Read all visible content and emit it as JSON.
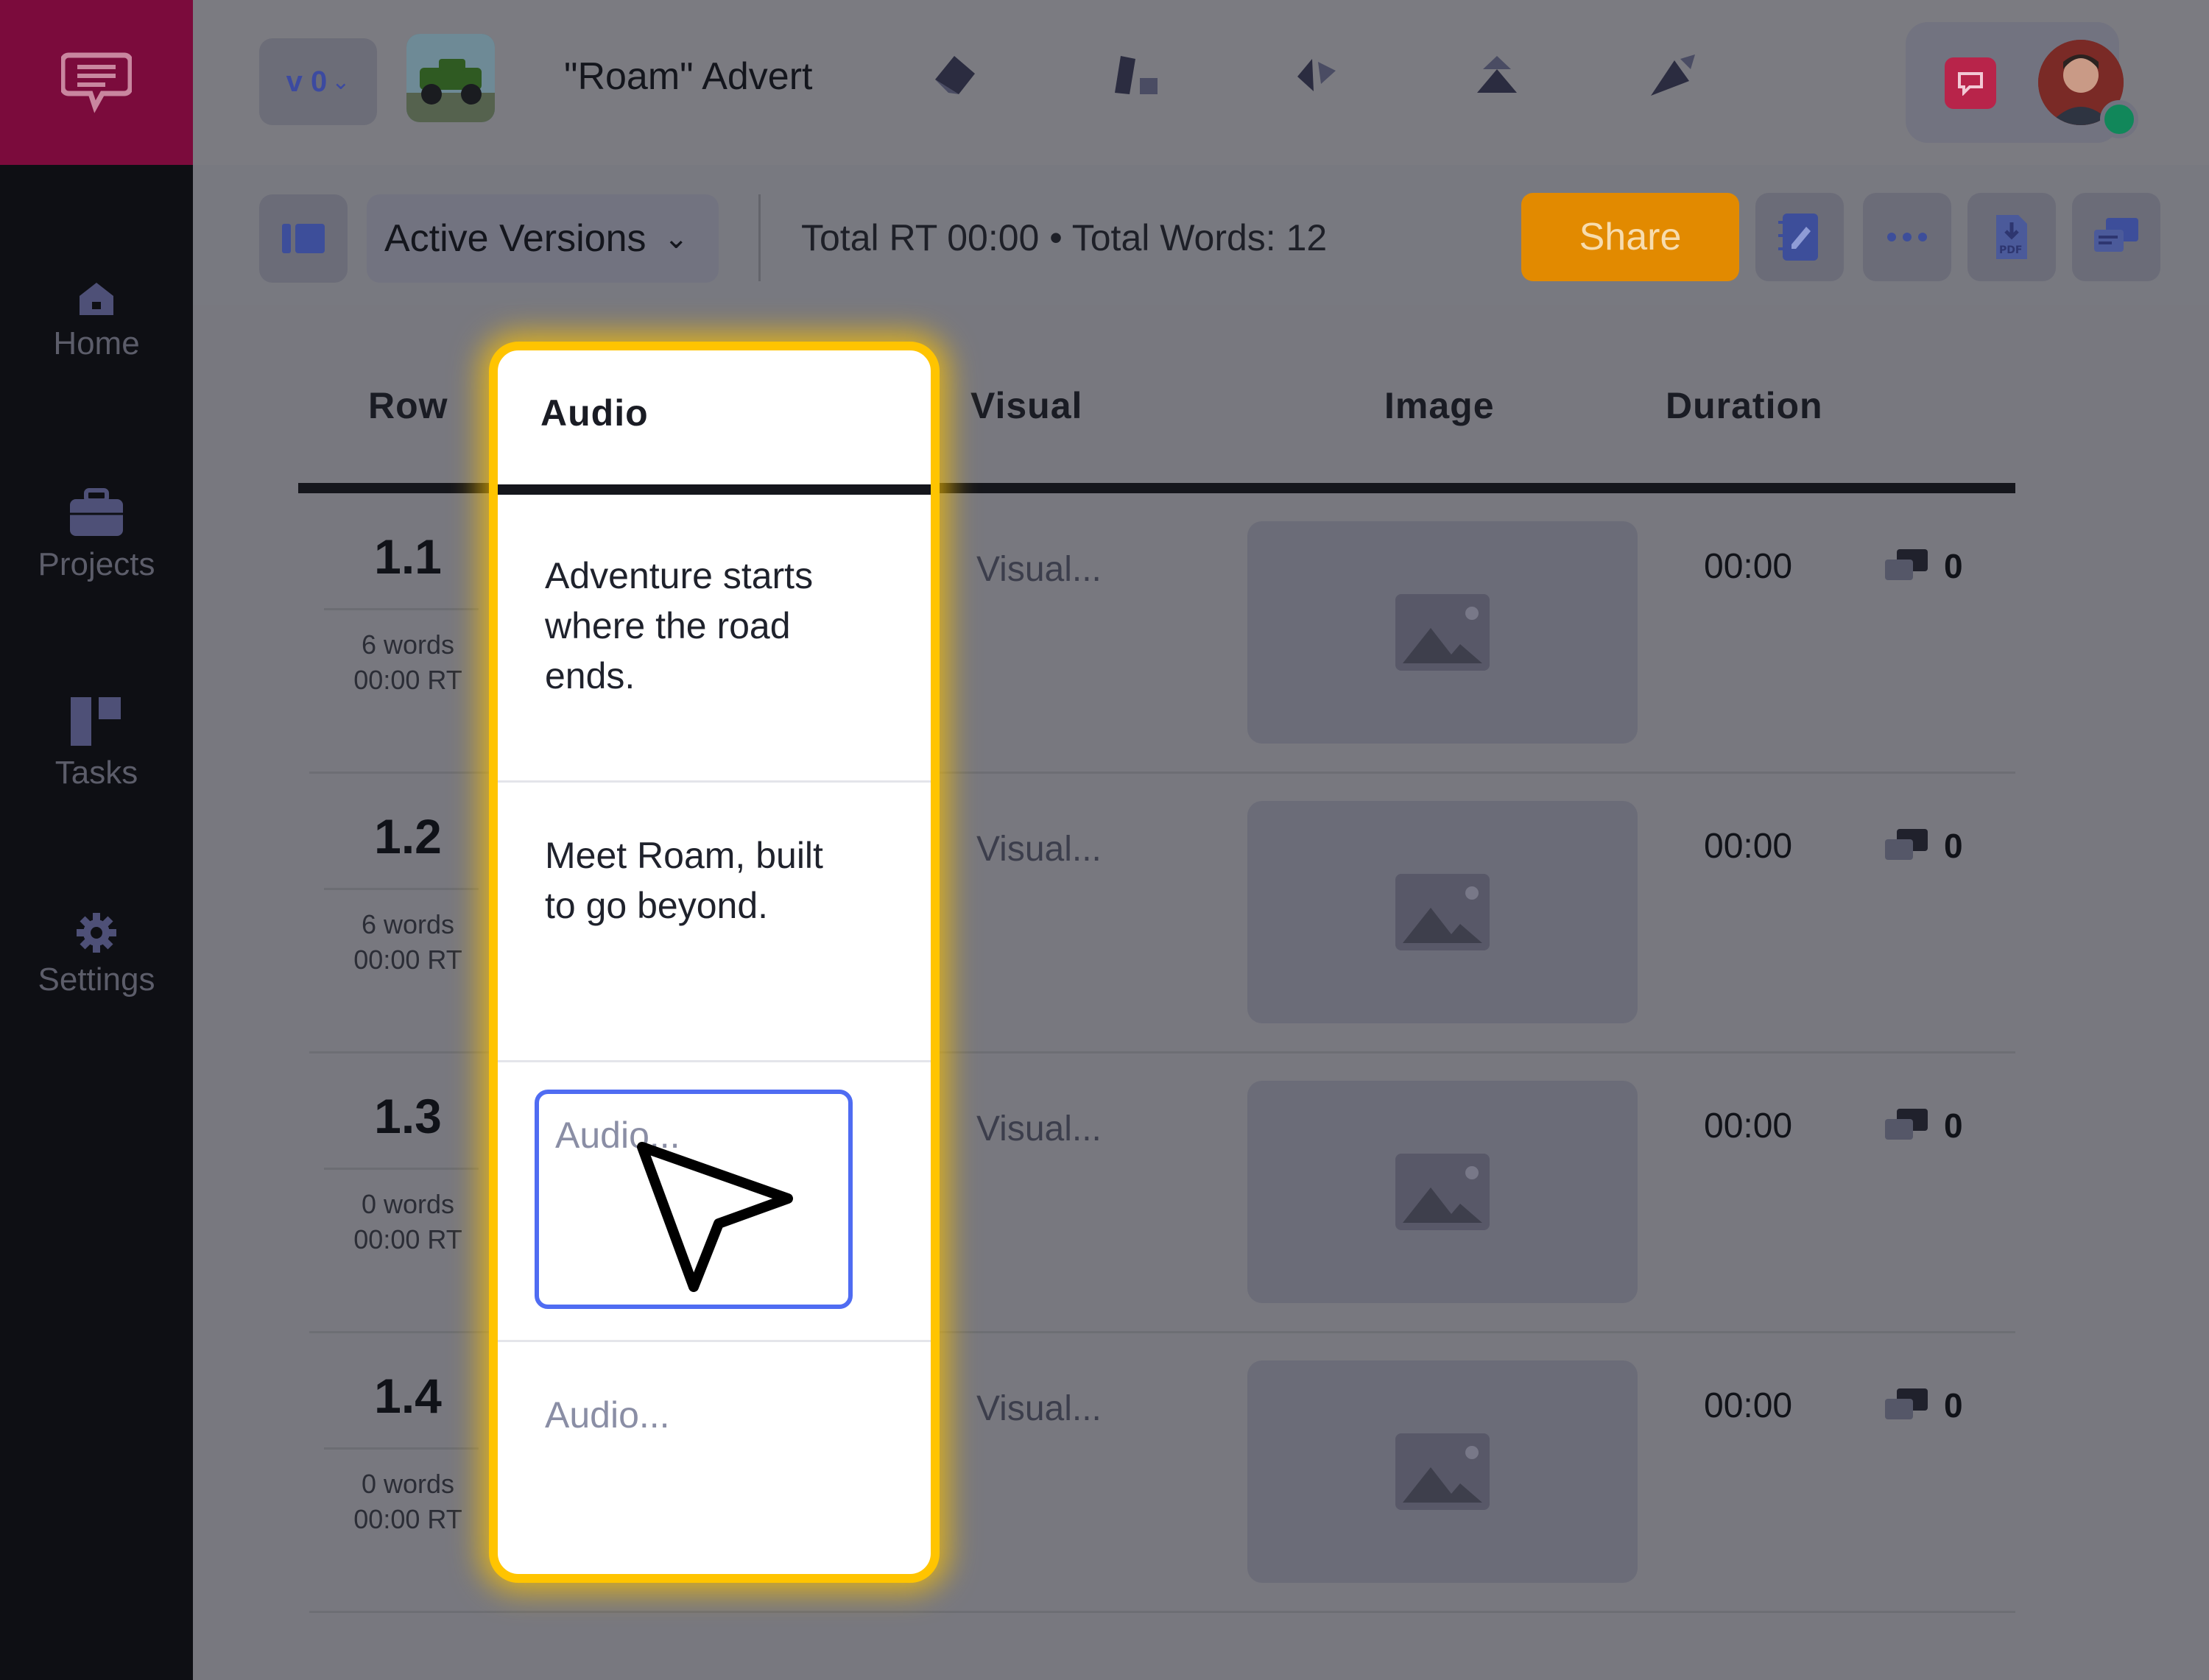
{
  "sidebar": {
    "items": [
      {
        "label": "Home",
        "icon": "home-icon"
      },
      {
        "label": "Projects",
        "icon": "briefcase-icon"
      },
      {
        "label": "Tasks",
        "icon": "tasks-icon"
      },
      {
        "label": "Settings",
        "icon": "gear-icon"
      }
    ]
  },
  "header": {
    "version_label": "v 0",
    "title": "\"Roam\" Advert"
  },
  "toolbar": {
    "versions_label": "Active Versions",
    "totals": "Total RT 00:00 • Total Words: 12",
    "share_label": "Share"
  },
  "table": {
    "headers": {
      "row": "Row",
      "audio": "Audio",
      "visual": "Visual",
      "image": "Image",
      "duration": "Duration"
    },
    "rows": [
      {
        "num": "1.1",
        "words": "6 words",
        "rt": "00:00 RT",
        "audio": "Adventure starts where the road ends.",
        "visual": "Visual...",
        "duration": "00:00",
        "comments": "0"
      },
      {
        "num": "1.2",
        "words": "6 words",
        "rt": "00:00 RT",
        "audio": "Meet Roam, built to go beyond.",
        "visual": "Visual...",
        "duration": "00:00",
        "comments": "0"
      },
      {
        "num": "1.3",
        "words": "0 words",
        "rt": "00:00 RT",
        "audio_placeholder": "Audio...",
        "visual": "Visual...",
        "duration": "00:00",
        "comments": "0"
      },
      {
        "num": "1.4",
        "words": "0 words",
        "rt": "00:00 RT",
        "audio_placeholder": "Audio...",
        "visual": "Visual...",
        "duration": "00:00",
        "comments": "0"
      }
    ]
  },
  "colors": {
    "brand": "#7b0b3c",
    "share": "#e28a00",
    "highlight": "#ffc400",
    "focus": "#4f6cf2"
  }
}
